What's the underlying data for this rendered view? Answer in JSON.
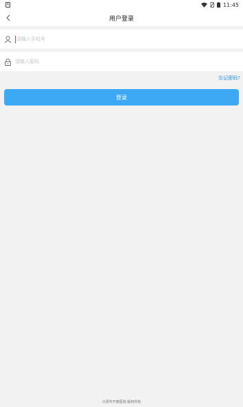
{
  "status_bar": {
    "time": "11:45",
    "icons": [
      "a-icon",
      "wifi-icon",
      "no-sim-icon",
      "battery-icon"
    ]
  },
  "header": {
    "title": "用户登录",
    "back_icon": "chevron-left-icon"
  },
  "form": {
    "phone_placeholder": "请输入手机号",
    "phone_icon": "user-icon",
    "password_placeholder": "请输入密码",
    "password_icon": "lock-icon",
    "cursor_color": "#e2336b"
  },
  "forgot_password": "忘记密码?",
  "login_button": "登录",
  "footer": "江阴市开泰医院 版权所有",
  "colors": {
    "accent": "#3da9f5",
    "link": "#2a8fe6",
    "background": "#f2f2f2"
  }
}
